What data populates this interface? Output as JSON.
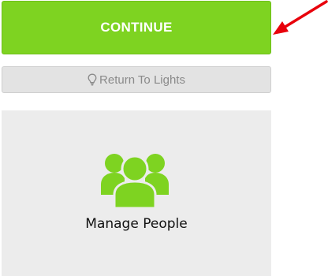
{
  "actions": {
    "continue_label": "CONTINUE",
    "return_label": "Return To Lights"
  },
  "tile": {
    "label": "Manage People",
    "icon": "people-group-icon"
  },
  "annotation": {
    "icon": "red-arrow-icon"
  },
  "colors": {
    "accent_green": "#7ed321",
    "secondary_gray": "#e3e3e3",
    "tile_bg": "#ececec",
    "arrow_red": "#e8000b"
  }
}
